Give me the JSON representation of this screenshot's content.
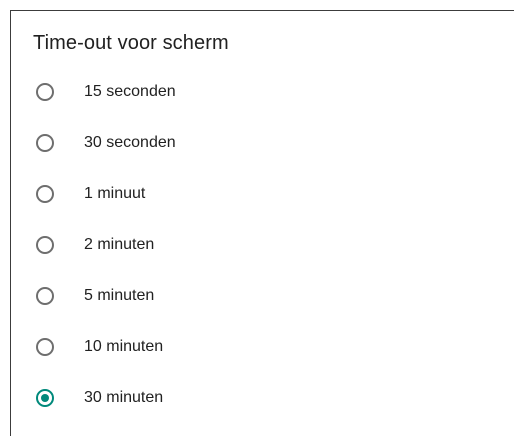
{
  "dialog": {
    "title": "Time-out voor scherm",
    "options": [
      {
        "label": "15 seconden",
        "selected": false
      },
      {
        "label": "30 seconden",
        "selected": false
      },
      {
        "label": "1 minuut",
        "selected": false
      },
      {
        "label": "2 minuten",
        "selected": false
      },
      {
        "label": "5 minuten",
        "selected": false
      },
      {
        "label": "10 minuten",
        "selected": false
      },
      {
        "label": "30 minuten",
        "selected": true
      }
    ],
    "accent_color": "#00897b"
  }
}
